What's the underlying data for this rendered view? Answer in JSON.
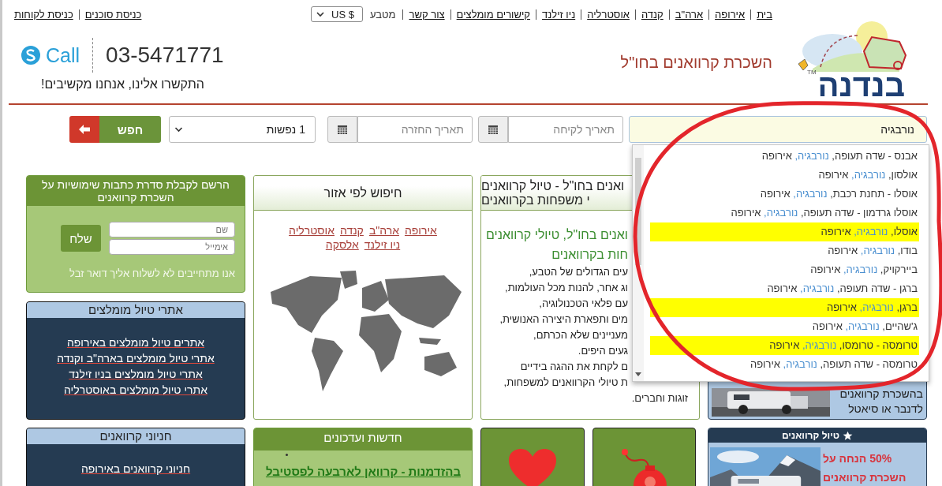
{
  "top_nav": {
    "links": [
      "בית",
      "אירופה",
      "ארה\"ב",
      "קנדה",
      "אוסטרליה",
      "ניו זילנד",
      "קישורים מומלצים",
      "צור קשר"
    ],
    "currency_label": "מטבע",
    "currency": "US $",
    "account_links": [
      "כניסת סוכנים",
      "כניסת לקוחות"
    ]
  },
  "logo": {
    "name": "בנדנה",
    "trademark": "TM"
  },
  "tagline": "השכרת קרוואנים בחו\"ל",
  "contact": {
    "call_label": "Call",
    "phone": "03-5471771",
    "note": "התקשרו אלינו, אנחנו מקשיבים!"
  },
  "search": {
    "destination": {
      "value": "נורבגיה",
      "suggestions": [
        {
          "place": "אבנס - שדה תעופה,",
          "country": "נורבגיה,",
          "region": "אירופה",
          "highlighted": false
        },
        {
          "place": "אולסון,",
          "country": "נורבגיה,",
          "region": "אירופה",
          "highlighted": false
        },
        {
          "place": "אוסלו - תחנת רכבת,",
          "country": "נורבגיה,",
          "region": "אירופה",
          "highlighted": false
        },
        {
          "place": "אוסלו גרדמון - שדה תעופה,",
          "country": "נורבגיה,",
          "region": "אירופה",
          "highlighted": false
        },
        {
          "place": "אוסלו,",
          "country": "נורבגיה,",
          "region": "אירופה",
          "highlighted": true
        },
        {
          "place": "בודו,",
          "country": "נורבגיה,",
          "region": "אירופה",
          "highlighted": false
        },
        {
          "place": "ביירקויק,",
          "country": "נורבגיה,",
          "region": "אירופה",
          "highlighted": false
        },
        {
          "place": "ברגן - שדה תעופה,",
          "country": "נורבגיה,",
          "region": "אירופה",
          "highlighted": false
        },
        {
          "place": "ברגן,",
          "country": "נורבגיה,",
          "region": "אירופה",
          "highlighted": true
        },
        {
          "place": "ג'שהיים,",
          "country": "נורבגיה,",
          "region": "אירופה",
          "highlighted": false
        },
        {
          "place": "טרומסה - טרומסו,",
          "country": "נורבגיה,",
          "region": "אירופה",
          "highlighted": true
        },
        {
          "place": "טרומסה - שדה תעופה,",
          "country": "נורבגיה,",
          "region": "אירופה",
          "highlighted": false
        }
      ]
    },
    "pickup_date": {
      "placeholder": "תאריך לקיחה"
    },
    "return_date": {
      "placeholder": "תאריך החזרה"
    },
    "passengers": "1 נפשות",
    "button": "חפש"
  },
  "featured_panel": {
    "lines": [
      "בהשכרת קרוואנים",
      "לדנבר או סיאטל"
    ]
  },
  "article": {
    "title_lines": [
      "ואנים בחו\"ל - טיול קרוואנים",
      "י משפחות בקרוואנים"
    ],
    "heading_lines": [
      "ואנים בחו\"ל, טיולי קרוואנים",
      "חות בקרוואנים"
    ],
    "lines": [
      "עים הגדולים של הטבע,",
      "וג אחר, להנות מכל העולמות,",
      "עם פלאי הטכנולוגיה,",
      "מים ותפארת היצירה האנושית,",
      "מעניינים שלא הכרתם,",
      "געים היפים.",
      "ם לקחת את ההגה בידיים",
      "ת טיולי הקרוואנים למשפחות,"
    ],
    "last_line": "זוגות וחברים."
  },
  "region_search": {
    "title": "חיפוש לפי אזור",
    "links": [
      "אירופה",
      "ארה\"ב",
      "קנדה",
      "אוסטרליה",
      "ניו זילנד",
      "אלסקה"
    ]
  },
  "newsletter": {
    "title": "הרשם לקבלת סדרת כתבות שימושיות על השכרת קרוואנים",
    "name_placeholder": "שם",
    "email_placeholder": "אימייל",
    "button": "שלח",
    "note": "אנו מתחייבים לא לשלוח אליך דואר זבל"
  },
  "recommended_sites": {
    "title": "אתרי טיול מומלצים",
    "links": [
      "אתרים טיול מומלצים באירופה",
      "אתרי טיול מומלצים בארה\"ב וקנדה",
      "אתרי טיול מומלצים בניו זילנד",
      "אתרי טיול מומלצים באוסטרליה"
    ]
  },
  "campsites": {
    "title": "חניוני קרוואנים",
    "links": [
      "חניוני קרוואנים באירופה"
    ]
  },
  "news": {
    "title": "חדשות ועדכונים",
    "items": [
      "בהזדמנות - קרוואן לארבעה לפסטיבל"
    ]
  },
  "promo_tiles": [
    {
      "kind": "bomb"
    },
    {
      "kind": "heart"
    }
  ],
  "rv_trip": {
    "title": "טיול קרוואנים",
    "offer": "50% הנחה על השכרת קרוואנים"
  }
}
